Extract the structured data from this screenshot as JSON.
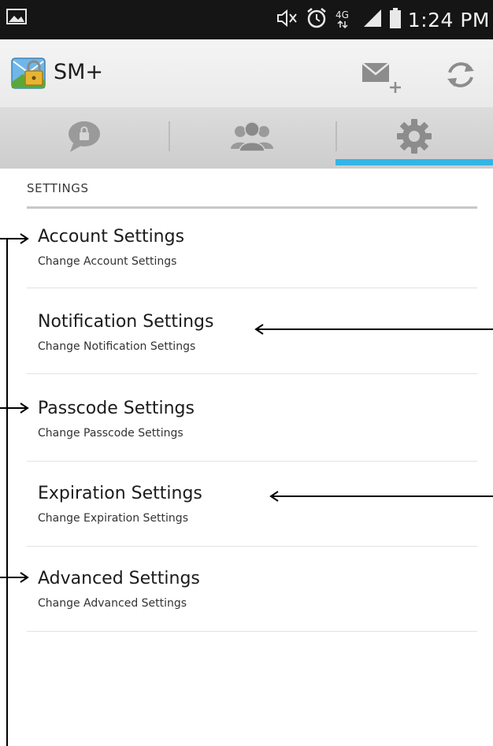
{
  "status_bar": {
    "time": "1:24 PM",
    "icons": [
      "image-icon",
      "mute-icon",
      "alarm-icon",
      "4g-lte-icon",
      "signal-icon",
      "battery-icon"
    ]
  },
  "action_bar": {
    "title": "SM+",
    "app_icon": "lock-envelope-icon",
    "actions": [
      "compose-message-icon",
      "refresh-icon"
    ]
  },
  "tabs": [
    {
      "icon": "chat-lock-icon",
      "selected": false
    },
    {
      "icon": "contacts-icon",
      "selected": false
    },
    {
      "icon": "gear-icon",
      "selected": true
    }
  ],
  "section": {
    "header": "SETTINGS"
  },
  "items": [
    {
      "title": "Account Settings",
      "subtitle": "Change Account Settings"
    },
    {
      "title": "Notification Settings",
      "subtitle": "Change Notification Settings"
    },
    {
      "title": "Passcode Settings",
      "subtitle": "Change Passcode Settings"
    },
    {
      "title": "Expiration Settings",
      "subtitle": "Change Expiration Settings"
    },
    {
      "title": "Advanced Settings",
      "subtitle": "Change Advanced Settings"
    }
  ],
  "colors": {
    "status_bar": "#151515",
    "action_bar": "#eeeeee",
    "tab_bar": "#d4d4d4",
    "tab_indicator": "#33b5e5",
    "text_primary": "#1b1b1b",
    "divider": "#e2e2e2"
  }
}
